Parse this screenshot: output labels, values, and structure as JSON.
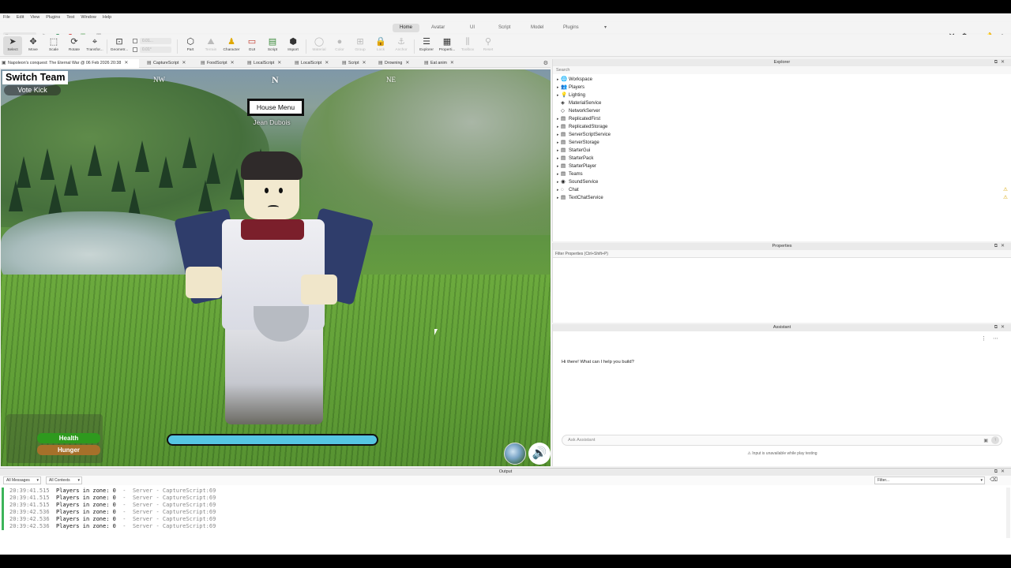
{
  "menubar": {
    "items": [
      "File",
      "Edit",
      "View",
      "Plugins",
      "Test",
      "Window",
      "Help"
    ]
  },
  "ribbon": {
    "run_mode": "Run",
    "tabs": [
      "Home",
      "Avatar",
      "UI",
      "Script",
      "Model",
      "Plugins"
    ],
    "active_tab": "Home",
    "more_label": "▾"
  },
  "toolbar": {
    "tools": [
      {
        "label": "Select",
        "icon": "pointer-icon"
      },
      {
        "label": "Move",
        "icon": "move-icon"
      },
      {
        "label": "Scale",
        "icon": "scale-icon"
      },
      {
        "label": "Rotate",
        "icon": "rotate-icon"
      },
      {
        "label": "Transfor...",
        "icon": "transform-icon"
      },
      {
        "label": "Geometr...",
        "icon": "geometry-icon"
      },
      {
        "label": "Part",
        "icon": "part-icon"
      },
      {
        "label": "Terrain",
        "icon": "terrain-icon"
      },
      {
        "label": "Character",
        "icon": "character-icon"
      },
      {
        "label": "GUI",
        "icon": "gui-icon"
      },
      {
        "label": "Script",
        "icon": "script-icon"
      },
      {
        "label": "Import",
        "icon": "import-icon"
      },
      {
        "label": "Material",
        "icon": "material-icon"
      },
      {
        "label": "Color",
        "icon": "color-icon"
      },
      {
        "label": "Group",
        "icon": "group-icon"
      },
      {
        "label": "Lock",
        "icon": "lock-icon"
      },
      {
        "label": "Anchor",
        "icon": "anchor-icon"
      },
      {
        "label": "Explorer",
        "icon": "explorer-icon"
      },
      {
        "label": "Properti...",
        "icon": "properties-icon"
      },
      {
        "label": "Toolbox",
        "icon": "toolbox-icon"
      },
      {
        "label": "Reset",
        "icon": "reset-icon"
      }
    ],
    "snap_move": "0.01...",
    "snap_rotate": "0.01°"
  },
  "doc_tabs": [
    "Napoleon's conquest: The Eternal War @ 06 Feb 2026 20:38",
    "CaptureScript",
    "FoodScript",
    "LocalScript",
    "LocalScript",
    "Script",
    "Drowning",
    "Eat anim"
  ],
  "game": {
    "switch_team": "Switch Team",
    "vote_kick": "Vote Kick",
    "compass": {
      "nw": "NW",
      "n": "N",
      "ne": "NE"
    },
    "house_menu": "House Menu",
    "player_name": "Jean Dubois",
    "health_label": "Health",
    "hunger_label": "Hunger",
    "progress_fraction": 1.0,
    "sound_icon": "🔊"
  },
  "explorer": {
    "title": "Explorer",
    "search_placeholder": "Search",
    "items": [
      {
        "label": "Workspace",
        "expandable": true,
        "icon": "🌐",
        "warn": false
      },
      {
        "label": "Players",
        "expandable": true,
        "icon": "👥",
        "warn": false
      },
      {
        "label": "Lighting",
        "expandable": true,
        "icon": "💡",
        "warn": false
      },
      {
        "label": "MaterialService",
        "expandable": false,
        "icon": "◈",
        "warn": false
      },
      {
        "label": "NetworkServer",
        "expandable": false,
        "icon": "◇",
        "warn": false
      },
      {
        "label": "ReplicatedFirst",
        "expandable": true,
        "icon": "▤",
        "warn": false
      },
      {
        "label": "ReplicatedStorage",
        "expandable": true,
        "icon": "▤",
        "warn": false
      },
      {
        "label": "ServerScriptService",
        "expandable": true,
        "icon": "▤",
        "warn": false
      },
      {
        "label": "ServerStorage",
        "expandable": true,
        "icon": "▤",
        "warn": false
      },
      {
        "label": "StarterGui",
        "expandable": true,
        "icon": "▤",
        "warn": false
      },
      {
        "label": "StarterPack",
        "expandable": true,
        "icon": "▤",
        "warn": false
      },
      {
        "label": "StarterPlayer",
        "expandable": true,
        "icon": "▤",
        "warn": false
      },
      {
        "label": "Teams",
        "expandable": true,
        "icon": "▤",
        "warn": false
      },
      {
        "label": "SoundService",
        "expandable": true,
        "icon": "◉",
        "warn": false
      },
      {
        "label": "Chat",
        "expandable": true,
        "icon": "◌",
        "warn": true
      },
      {
        "label": "TextChatService",
        "expandable": true,
        "icon": "▤",
        "warn": true
      }
    ]
  },
  "properties": {
    "title": "Properties",
    "filter_placeholder": "Filter Properties (Ctrl+Shift+P)"
  },
  "assistant": {
    "title": "Assistant",
    "greeting": "Hi there! What can I help you build?",
    "input_placeholder": "Ask Assistant",
    "note": "Input is unavailable while play testing"
  },
  "output": {
    "title": "Output",
    "message_filter": "All Messages",
    "context_filter": "All Contexts",
    "search_placeholder": "Filter...",
    "lines": [
      {
        "time": "20:39:41.515",
        "msg": "Players in zone: 0",
        "src": "  -  Server - CaptureScript:69"
      },
      {
        "time": "20:39:41.515",
        "msg": "Players in zone: 0",
        "src": "  -  Server - CaptureScript:69"
      },
      {
        "time": "20:39:41.515",
        "msg": "Players in zone: 0",
        "src": "  -  Server - CaptureScript:69"
      },
      {
        "time": "20:39:42.536",
        "msg": "Players in zone: 0",
        "src": "  -  Server - CaptureScript:69"
      },
      {
        "time": "20:39:42.536",
        "msg": "Players in zone: 0",
        "src": "  -  Server - CaptureScript:69"
      },
      {
        "time": "20:39:42.536",
        "msg": "Players in zone: 0",
        "src": "  -  Server - CaptureScript:69"
      }
    ]
  },
  "colors": {
    "health": "#2e9a1e",
    "hunger": "#a6702a",
    "progress": "#56c6e3",
    "log_stripe": "#3cb45a",
    "warning": "#d8a400"
  }
}
